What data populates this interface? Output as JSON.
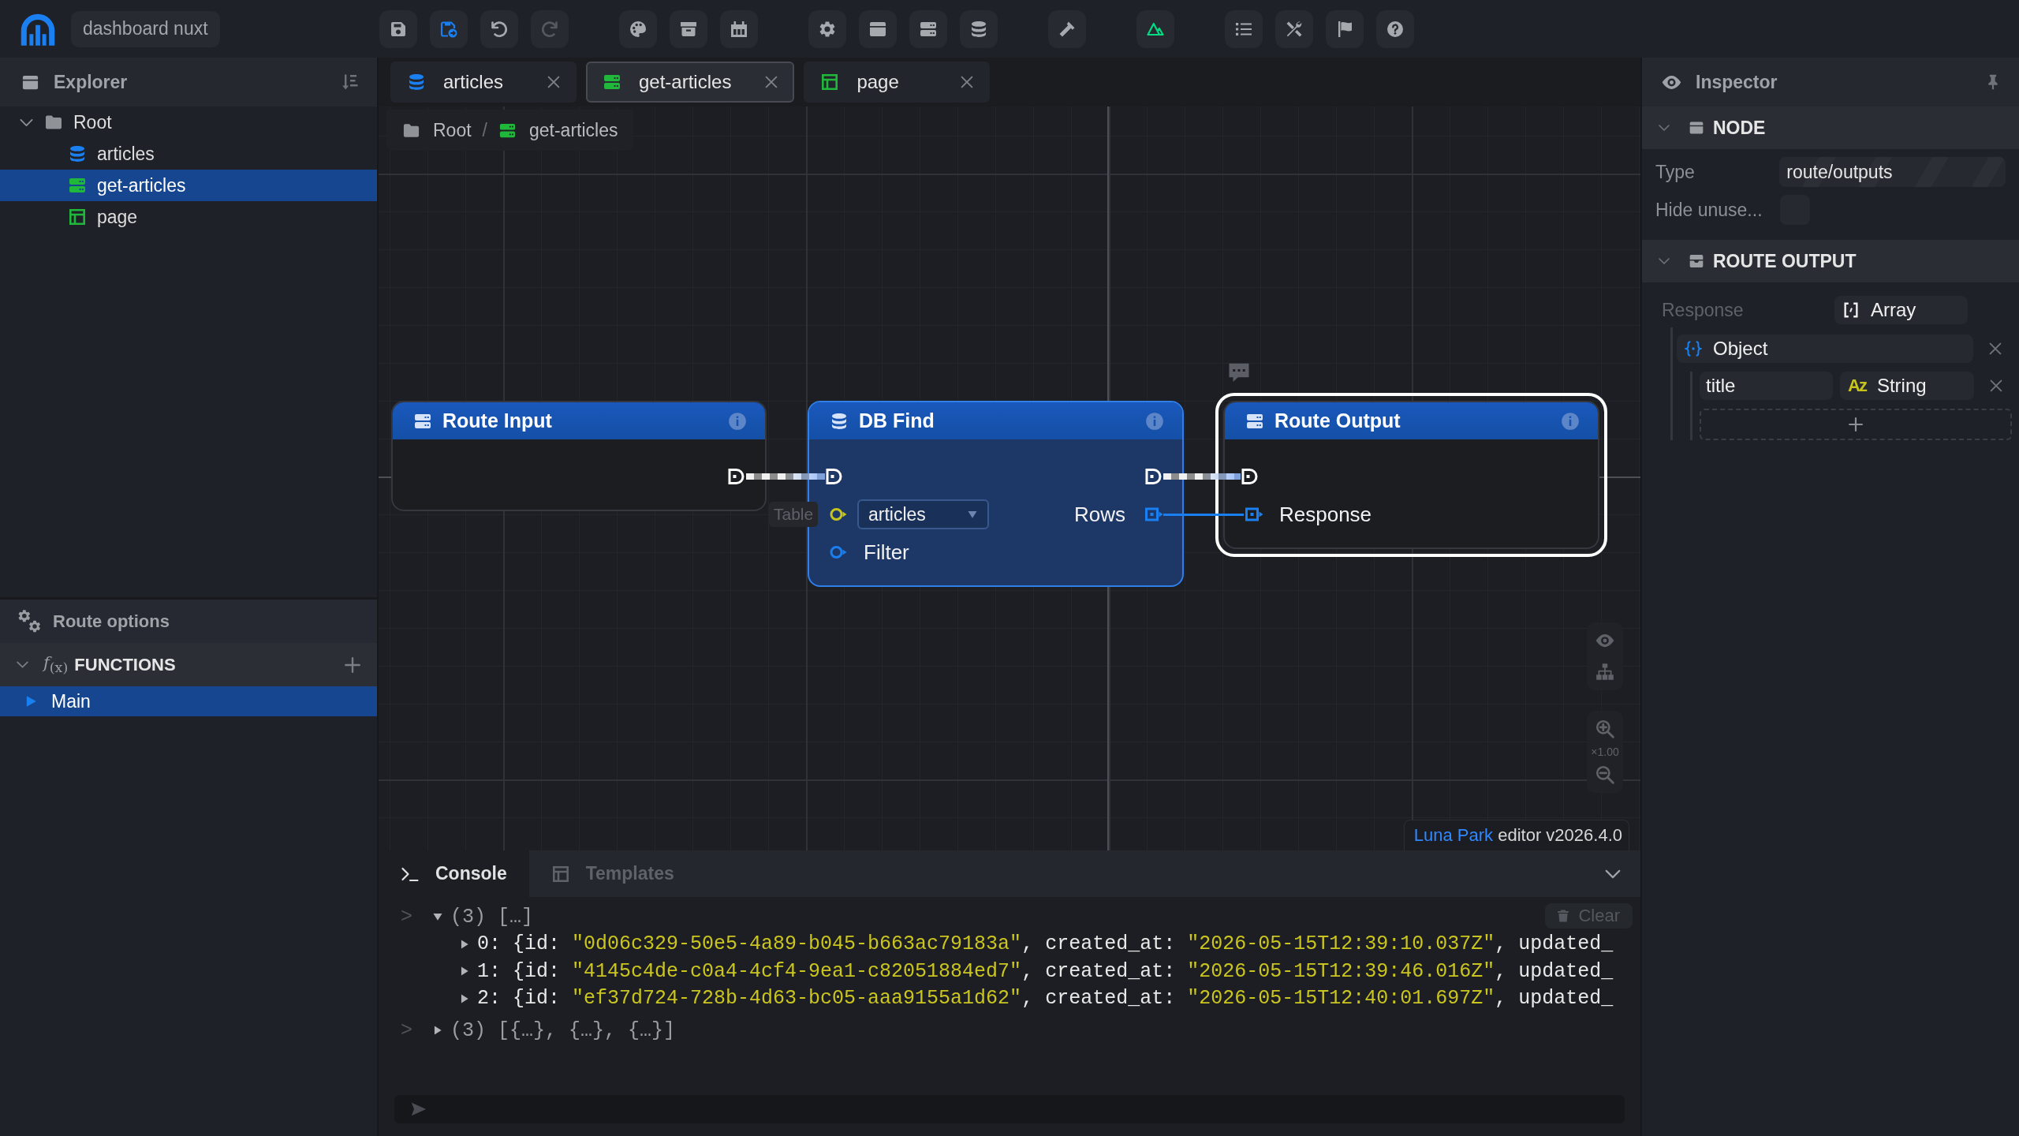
{
  "top_bar": {
    "project": "dashboard nuxt"
  },
  "toolbar": {
    "undo": {
      "disabled": false
    },
    "redo": {
      "disabled": true
    }
  },
  "explorer": {
    "title": "Explorer",
    "tree": [
      {
        "label": "Root",
        "kind": "folder",
        "expanded": true,
        "selected": false,
        "children": [
          {
            "label": "articles",
            "kind": "table",
            "selected": false
          },
          {
            "label": "get-articles",
            "kind": "route",
            "selected": true
          },
          {
            "label": "page",
            "kind": "page",
            "selected": false
          }
        ]
      }
    ]
  },
  "route_options": {
    "title": "Route options"
  },
  "functions": {
    "title": "FUNCTIONS",
    "icon": "*f*$_{(x)}$",
    "expanded": true,
    "items": [
      {
        "label": "Main",
        "selected": true
      }
    ]
  },
  "editor_tabs": [
    {
      "label": "articles",
      "kind": "table",
      "selected": false
    },
    {
      "label": "get-articles",
      "kind": "route",
      "selected": true
    },
    {
      "label": "page",
      "kind": "page",
      "selected": false
    }
  ],
  "breadcrumb": {
    "separator": "/",
    "items": [
      {
        "label": "Root",
        "kind": "folder"
      },
      {
        "label": "get-articles",
        "kind": "route"
      }
    ]
  },
  "graph": {
    "nodes": [
      {
        "title": "Route Input",
        "kind": "route_input",
        "selected": false,
        "highlighted": false,
        "exec_out": {
          "connected": true
        }
      },
      {
        "title": "DB Find",
        "kind": "db_find",
        "selected": false,
        "highlighted": true,
        "exec_in": {
          "connected": true
        },
        "exec_out": {
          "connected": true
        },
        "inputs": [
          {
            "label": "Table",
            "kind": "select",
            "value": "articles",
            "color": "#c8c41c",
            "connected": false
          },
          {
            "label": "Filter",
            "kind": "value",
            "color": "#1a7ff0",
            "connected": false
          }
        ],
        "outputs": [
          {
            "label": "Rows",
            "kind": "list",
            "color": "#1a7ff0",
            "connected": true
          }
        ]
      },
      {
        "title": "Route Output",
        "kind": "route_output",
        "selected": true,
        "highlighted": false,
        "exec_in": {
          "connected": true
        },
        "inputs": [
          {
            "label": "Response",
            "kind": "list",
            "color": "#1a7ff0",
            "connected": true
          }
        ]
      }
    ],
    "zoom": "×1.00"
  },
  "credit": {
    "brand": "Luna Park",
    "text": "editor v2026.4.0"
  },
  "console": {
    "tabs": [
      {
        "label": "Console",
        "kind": "terminal",
        "selected": true
      },
      {
        "label": "Templates",
        "kind": "templates",
        "selected": false
      }
    ],
    "clear": {
      "label": "Clear",
      "disabled": true
    },
    "entries": [
      {
        "prompt": ">",
        "expanded": true,
        "segments": [
          {
            "text": "(3) […]",
            "kind": "meta"
          }
        ],
        "children": [
          {
            "expanded": false,
            "segments": [
              {
                "text": "0: {id: ",
                "kind": "plain"
              },
              {
                "text": "\"0d06c329-50e5-4a89-b045-b663ac79183a\"",
                "kind": "string"
              },
              {
                "text": ", created_at: ",
                "kind": "plain"
              },
              {
                "text": "\"2026-05-15T12:39:10.037Z\"",
                "kind": "string"
              },
              {
                "text": ", updated_",
                "kind": "plain"
              }
            ]
          },
          {
            "expanded": false,
            "segments": [
              {
                "text": "1: {id: ",
                "kind": "plain"
              },
              {
                "text": "\"4145c4de-c0a4-4cf4-9ea1-c82051884ed7\"",
                "kind": "string"
              },
              {
                "text": ", created_at: ",
                "kind": "plain"
              },
              {
                "text": "\"2026-05-15T12:39:46.016Z\"",
                "kind": "string"
              },
              {
                "text": ", updated_",
                "kind": "plain"
              }
            ]
          },
          {
            "expanded": false,
            "segments": [
              {
                "text": "2: {id: ",
                "kind": "plain"
              },
              {
                "text": "\"ef37d724-728b-4d63-bc05-aaa9155a1d62\"",
                "kind": "string"
              },
              {
                "text": ", created_at: ",
                "kind": "plain"
              },
              {
                "text": "\"2026-05-15T12:40:01.697Z\"",
                "kind": "string"
              },
              {
                "text": ", updated_",
                "kind": "plain"
              }
            ]
          }
        ]
      },
      {
        "prompt": ">",
        "expanded": false,
        "segments": [
          {
            "text": "(3) [{…}, {…}, {…}]",
            "kind": "meta"
          }
        ]
      }
    ]
  },
  "inspector": {
    "title": "Inspector",
    "sections": [
      {
        "title": "NODE",
        "kind": "node",
        "expanded": true,
        "fields": [
          {
            "label": "Type",
            "kind": "text",
            "value": "route/outputs",
            "disabled": true
          },
          {
            "label": "Hide unuse...",
            "kind": "checkbox",
            "checked": false
          }
        ]
      },
      {
        "title": "ROUTE OUTPUT",
        "kind": "route_output",
        "expanded": true,
        "schema": {
          "label": "Response",
          "type": "Array",
          "kind": "array",
          "children": [
            {
              "type": "Object",
              "kind": "object",
              "children": [
                {
                  "name": "title",
                  "type": "String",
                  "kind": "string",
                  "type_icon": "Az"
                }
              ]
            }
          ]
        }
      }
    ]
  }
}
